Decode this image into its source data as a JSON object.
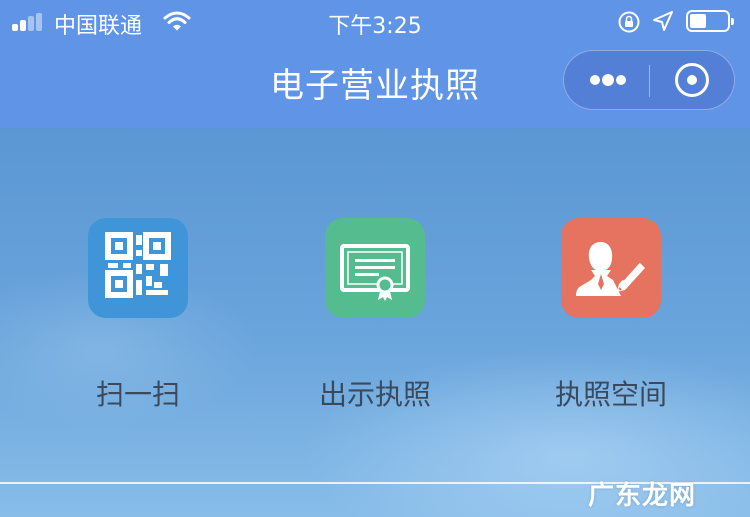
{
  "status_bar": {
    "carrier": "中国联通",
    "time": "下午3:25"
  },
  "nav": {
    "title": "电子营业执照"
  },
  "actions": [
    {
      "label": "扫一扫",
      "icon": "qr-code-icon",
      "color": "#3f95d8"
    },
    {
      "label": "出示执照",
      "icon": "certificate-icon",
      "color": "#54bc8e"
    },
    {
      "label": "执照空间",
      "icon": "user-edit-icon",
      "color": "#e5735f"
    }
  ],
  "watermark": "广东龙网"
}
